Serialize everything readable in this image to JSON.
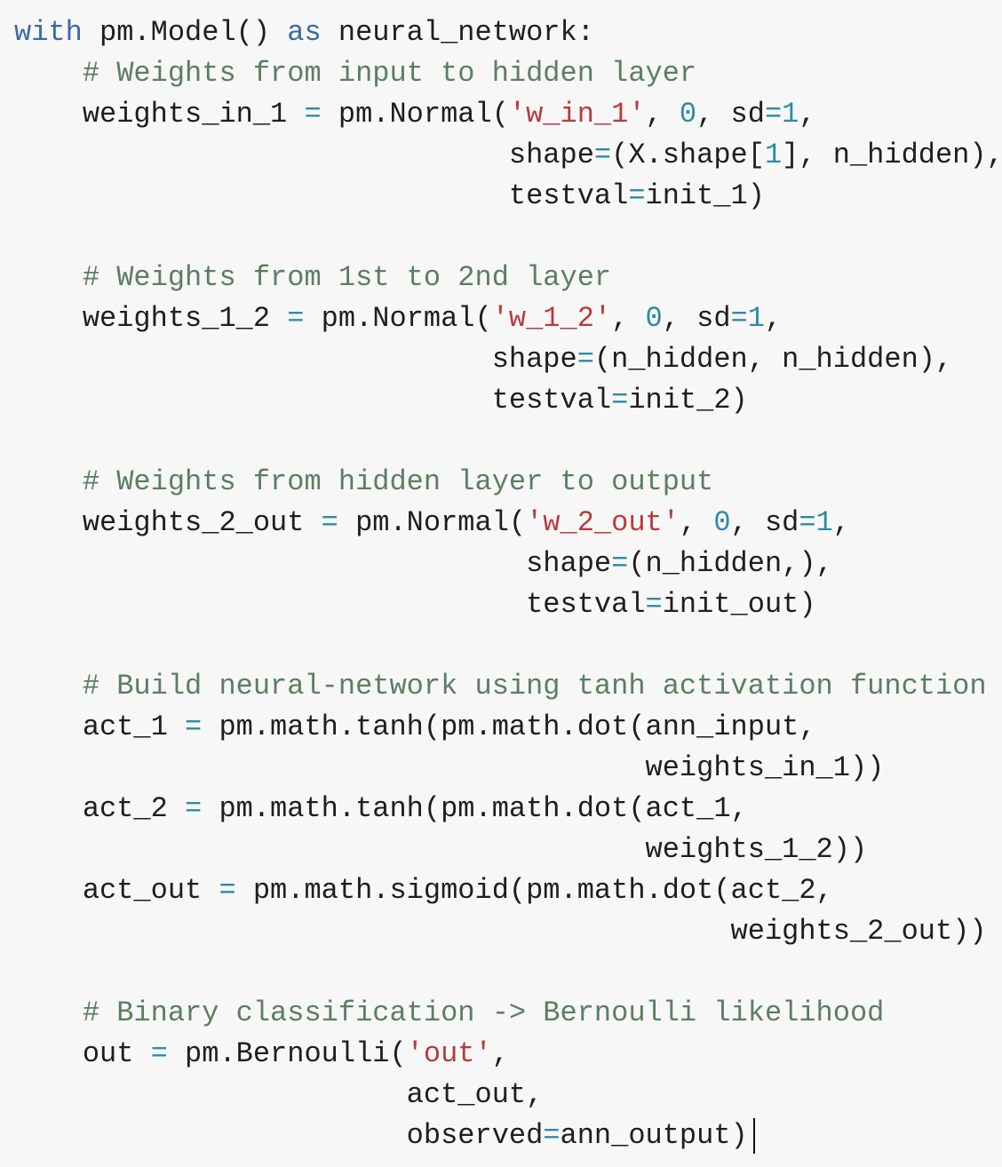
{
  "editor": {
    "background": "#f7f7f7",
    "colors": {
      "keyword": "#3b6aa0",
      "comment": "#5b7e62",
      "string": "#b83b3b",
      "number": "#2d8ba6",
      "operator": "#2d8ba6",
      "text": "#1e1e1e"
    },
    "lines": [
      [
        {
          "t": "kw",
          "v": "with"
        },
        {
          "t": "text",
          "v": " pm.Model() "
        },
        {
          "t": "kw",
          "v": "as"
        },
        {
          "t": "text",
          "v": " neural_network:"
        }
      ],
      [
        {
          "t": "text",
          "v": "    "
        },
        {
          "t": "comment",
          "v": "# Weights from input to hidden layer"
        }
      ],
      [
        {
          "t": "text",
          "v": "    weights_in_1 "
        },
        {
          "t": "op",
          "v": "="
        },
        {
          "t": "text",
          "v": " pm.Normal("
        },
        {
          "t": "str",
          "v": "'w_in_1'"
        },
        {
          "t": "text",
          "v": ", "
        },
        {
          "t": "num",
          "v": "0"
        },
        {
          "t": "text",
          "v": ", sd"
        },
        {
          "t": "op",
          "v": "="
        },
        {
          "t": "num",
          "v": "1"
        },
        {
          "t": "text",
          "v": ","
        }
      ],
      [
        {
          "t": "text",
          "v": "                             shape"
        },
        {
          "t": "op",
          "v": "="
        },
        {
          "t": "text",
          "v": "(X.shape["
        },
        {
          "t": "num",
          "v": "1"
        },
        {
          "t": "text",
          "v": "], n_hidden),"
        }
      ],
      [
        {
          "t": "text",
          "v": "                             testval"
        },
        {
          "t": "op",
          "v": "="
        },
        {
          "t": "text",
          "v": "init_1)"
        }
      ],
      [
        {
          "t": "text",
          "v": ""
        }
      ],
      [
        {
          "t": "text",
          "v": "    "
        },
        {
          "t": "comment",
          "v": "# Weights from 1st to 2nd layer"
        }
      ],
      [
        {
          "t": "text",
          "v": "    weights_1_2 "
        },
        {
          "t": "op",
          "v": "="
        },
        {
          "t": "text",
          "v": " pm.Normal("
        },
        {
          "t": "str",
          "v": "'w_1_2'"
        },
        {
          "t": "text",
          "v": ", "
        },
        {
          "t": "num",
          "v": "0"
        },
        {
          "t": "text",
          "v": ", sd"
        },
        {
          "t": "op",
          "v": "="
        },
        {
          "t": "num",
          "v": "1"
        },
        {
          "t": "text",
          "v": ","
        }
      ],
      [
        {
          "t": "text",
          "v": "                            shape"
        },
        {
          "t": "op",
          "v": "="
        },
        {
          "t": "text",
          "v": "(n_hidden, n_hidden),"
        }
      ],
      [
        {
          "t": "text",
          "v": "                            testval"
        },
        {
          "t": "op",
          "v": "="
        },
        {
          "t": "text",
          "v": "init_2)"
        }
      ],
      [
        {
          "t": "text",
          "v": ""
        }
      ],
      [
        {
          "t": "text",
          "v": "    "
        },
        {
          "t": "comment",
          "v": "# Weights from hidden layer to output"
        }
      ],
      [
        {
          "t": "text",
          "v": "    weights_2_out "
        },
        {
          "t": "op",
          "v": "="
        },
        {
          "t": "text",
          "v": " pm.Normal("
        },
        {
          "t": "str",
          "v": "'w_2_out'"
        },
        {
          "t": "text",
          "v": ", "
        },
        {
          "t": "num",
          "v": "0"
        },
        {
          "t": "text",
          "v": ", sd"
        },
        {
          "t": "op",
          "v": "="
        },
        {
          "t": "num",
          "v": "1"
        },
        {
          "t": "text",
          "v": ","
        }
      ],
      [
        {
          "t": "text",
          "v": "                              shape"
        },
        {
          "t": "op",
          "v": "="
        },
        {
          "t": "text",
          "v": "(n_hidden,),"
        }
      ],
      [
        {
          "t": "text",
          "v": "                              testval"
        },
        {
          "t": "op",
          "v": "="
        },
        {
          "t": "text",
          "v": "init_out)"
        }
      ],
      [
        {
          "t": "text",
          "v": ""
        }
      ],
      [
        {
          "t": "text",
          "v": "    "
        },
        {
          "t": "comment",
          "v": "# Build neural-network using tanh activation function"
        }
      ],
      [
        {
          "t": "text",
          "v": "    act_1 "
        },
        {
          "t": "op",
          "v": "="
        },
        {
          "t": "text",
          "v": " pm.math.tanh(pm.math.dot(ann_input,"
        }
      ],
      [
        {
          "t": "text",
          "v": "                                     weights_in_1))"
        }
      ],
      [
        {
          "t": "text",
          "v": "    act_2 "
        },
        {
          "t": "op",
          "v": "="
        },
        {
          "t": "text",
          "v": " pm.math.tanh(pm.math.dot(act_1,"
        }
      ],
      [
        {
          "t": "text",
          "v": "                                     weights_1_2))"
        }
      ],
      [
        {
          "t": "text",
          "v": "    act_out "
        },
        {
          "t": "op",
          "v": "="
        },
        {
          "t": "text",
          "v": " pm.math.sigmoid(pm.math.dot(act_2,"
        }
      ],
      [
        {
          "t": "text",
          "v": "                                          weights_2_out))"
        }
      ],
      [
        {
          "t": "text",
          "v": ""
        }
      ],
      [
        {
          "t": "text",
          "v": "    "
        },
        {
          "t": "comment",
          "v": "# Binary classification -> Bernoulli likelihood"
        }
      ],
      [
        {
          "t": "text",
          "v": "    out "
        },
        {
          "t": "op",
          "v": "="
        },
        {
          "t": "text",
          "v": " pm.Bernoulli("
        },
        {
          "t": "str",
          "v": "'out'"
        },
        {
          "t": "text",
          "v": ","
        }
      ],
      [
        {
          "t": "text",
          "v": "                       act_out,"
        }
      ],
      [
        {
          "t": "text",
          "v": "                       observed"
        },
        {
          "t": "op",
          "v": "="
        },
        {
          "t": "text",
          "v": "ann_output)"
        }
      ]
    ]
  }
}
